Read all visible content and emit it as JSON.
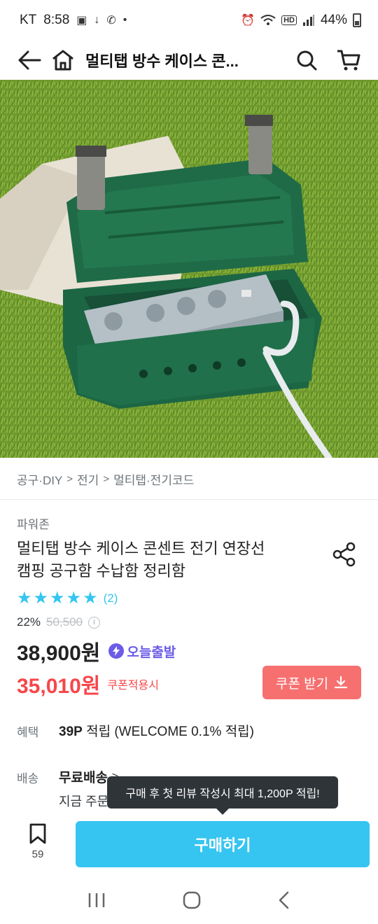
{
  "status_bar": {
    "carrier": "KT",
    "time": "8:58",
    "battery": "44%",
    "icons": [
      "gallery-icon",
      "download-icon",
      "wifi-calling-icon",
      "dot-icon",
      "alarm-icon",
      "wifi-icon",
      "hd-icon",
      "signal-icon",
      "battery-icon"
    ]
  },
  "header": {
    "title": "멀티탭 방수 케이스 콘...",
    "icons": [
      "back-arrow-icon",
      "home-icon",
      "search-icon",
      "cart-icon"
    ]
  },
  "breadcrumb": {
    "items": [
      "공구·DIY",
      "전기",
      "멀티탭·전기코드"
    ]
  },
  "product": {
    "brand": "파워존",
    "name_line1": "멀티탭 방수 케이스 콘센트 전기 연장선",
    "name_line2": "캠핑 공구함 수납함 정리함",
    "rating": 5,
    "review_count": "(2)",
    "discount_rate": "22%",
    "original_price": "50,500",
    "price": "38,900원",
    "today_badge": "오늘출발",
    "coupon_price": "35,010원",
    "coupon_note": "쿠폰적용시",
    "coupon_button": "쿠폰 받기"
  },
  "benefit": {
    "label": "혜택",
    "points": "39P",
    "text": " 적립 (WELCOME 0.1% 적립)"
  },
  "shipping": {
    "label": "배송",
    "main": "무료배송",
    "sub": "지금 주문"
  },
  "tooltip": {
    "text": "구매 후 첫 리뷰 작성시 최대 1,200P 적립!"
  },
  "actions": {
    "bookmark_count": "59",
    "buy_label": "구매하기"
  },
  "colors": {
    "accent": "#35c5f0",
    "coupon_red": "#f7464b",
    "coupon_button": "#f77070",
    "badge_purple": "#6c5ce7"
  }
}
